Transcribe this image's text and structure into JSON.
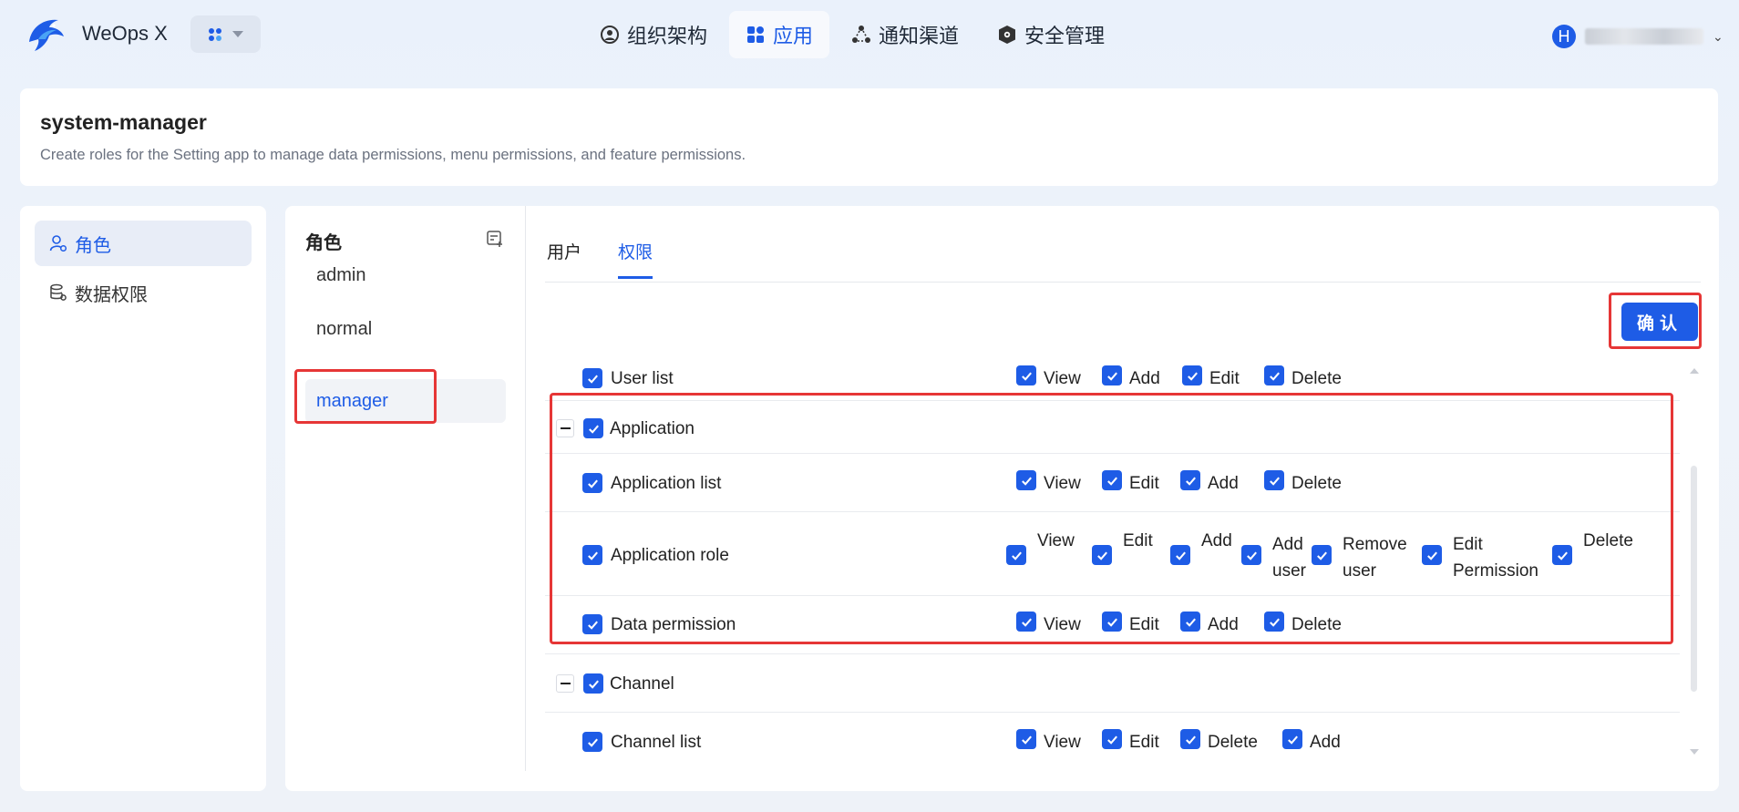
{
  "header": {
    "brand": "WeOps X",
    "nav": [
      {
        "label": "组织架构",
        "icon": "user-circle-icon",
        "active": false
      },
      {
        "label": "应用",
        "icon": "apps-grid-icon",
        "active": true
      },
      {
        "label": "通知渠道",
        "icon": "share-nodes-icon",
        "active": false
      },
      {
        "label": "安全管理",
        "icon": "shield-gear-icon",
        "active": false
      }
    ],
    "user_avatar": "H"
  },
  "page": {
    "title": "system-manager",
    "description": "Create roles for the Setting app to manage data permissions, menu permissions, and feature permissions."
  },
  "sidebar": {
    "items": [
      {
        "label": "角色",
        "icon": "user-gear-icon",
        "active": true
      },
      {
        "label": "数据权限",
        "icon": "database-gear-icon",
        "active": false
      }
    ]
  },
  "roles": {
    "title": "角色",
    "items": [
      "admin",
      "normal",
      "manager"
    ],
    "selected": "manager"
  },
  "tabs": [
    {
      "label": "用户",
      "active": false
    },
    {
      "label": "权限",
      "active": true
    }
  ],
  "confirm_label": "确认",
  "permissions": {
    "user_list": {
      "label": "User list",
      "actions": [
        "View",
        "Add",
        "Edit",
        "Delete"
      ]
    },
    "application": {
      "label": "Application",
      "children": {
        "application_list": {
          "label": "Application list",
          "actions": [
            "View",
            "Edit",
            "Add",
            "Delete"
          ]
        },
        "application_role": {
          "label": "Application role",
          "actions": [
            "View",
            "Edit",
            "Add",
            "Add user",
            "Remove user",
            "Edit Permission",
            "Delete"
          ]
        },
        "data_permission": {
          "label": "Data permission",
          "actions": [
            "View",
            "Edit",
            "Add",
            "Delete"
          ]
        }
      }
    },
    "channel": {
      "label": "Channel",
      "children": {
        "channel_list": {
          "label": "Channel list",
          "actions": [
            "View",
            "Edit",
            "Delete",
            "Add"
          ]
        }
      }
    }
  },
  "colors": {
    "accent": "#1e5ce6",
    "annotation": "#e63636"
  }
}
